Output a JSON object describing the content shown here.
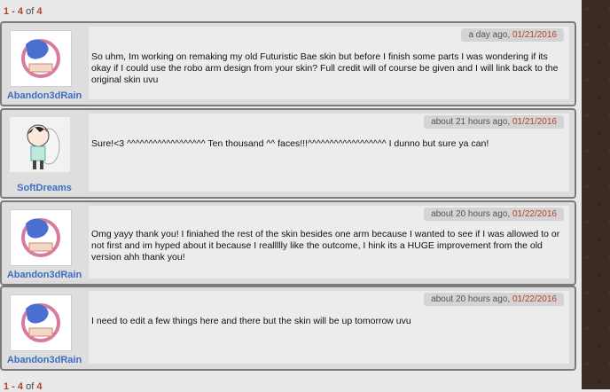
{
  "pager": {
    "start": "1",
    "sep": " - ",
    "end": "4",
    "of_label": " of ",
    "total": "4"
  },
  "posts": [
    {
      "author": "Abandon3dRain",
      "time": "a day ago,",
      "date": "01/21/2016",
      "text": "So uhm, Im working on remaking my old Futuristic Bae skin but before I finish some parts I was wondering if its okay if I could use the robo arm design from your skin? Full credit will of course be given and I will link back to the original skin uvu"
    },
    {
      "author": "SoftDreams",
      "time": "about 21 hours ago,",
      "date": "01/21/2016",
      "text": "Sure!<3 ^^^^^^^^^^^^^^^^^^ Ten thousand ^^ faces!!!^^^^^^^^^^^^^^^^^^ I dunno but sure ya can!"
    },
    {
      "author": "Abandon3dRain",
      "time": "about 20 hours ago,",
      "date": "01/22/2016",
      "text": "Omg yayy thank you! I finiahed the rest of the skin besides one arm because I wanted to see if I was allowed to or not first and im hyped about it because I reallllly like the outcome, I hink its a HUGE improvement from the old version ahh thank you!"
    },
    {
      "author": "Abandon3dRain",
      "time": "about 20 hours ago,",
      "date": "01/22/2016",
      "text": "I need to edit a few things here and there but the skin will be up tomorrow uvu"
    }
  ],
  "colors": {
    "accent": "#b5412d",
    "username": "#3a6fc4",
    "avatar_logo": "#4a6fd0",
    "avatar_ring": "#d97aa0"
  }
}
